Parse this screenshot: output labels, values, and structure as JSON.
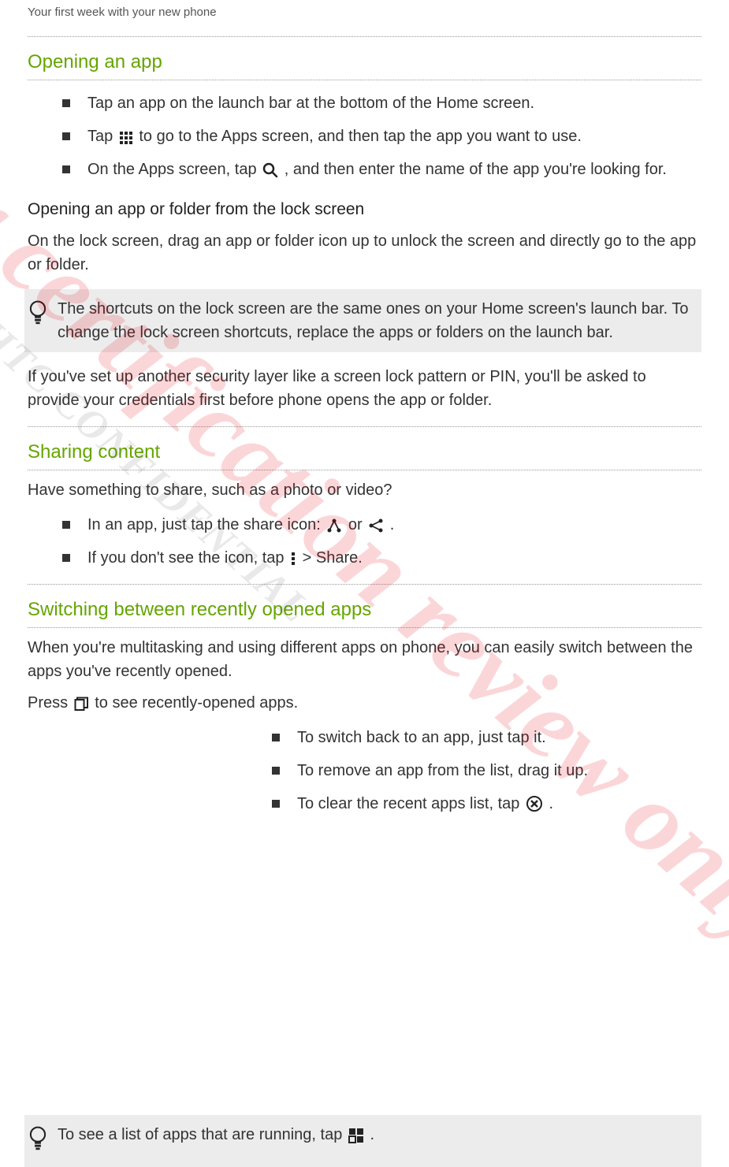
{
  "header": "Your first week with your new phone",
  "s1": {
    "heading": "Opening an app",
    "bullets": {
      "b1": "Tap an app on the launch bar at the bottom of the Home screen.",
      "b2a": "Tap ",
      "b2b": " to go to the Apps screen, and then tap the app you want to use.",
      "b3a": "On the Apps screen, tap ",
      "b3b": ", and then enter the name of the app you're looking for."
    },
    "sub_heading": "Opening an app or folder from the lock screen",
    "p1": "On the lock screen, drag an app or folder icon up to unlock the screen and directly go to the app or folder.",
    "tip": "The shortcuts on the lock screen are the same ones on your Home screen's launch bar. To change the lock screen shortcuts, replace the apps or folders on the launch bar.",
    "p2": "If you've set up another security layer like a screen lock pattern or PIN, you'll be asked to provide your credentials first before phone opens the app or folder."
  },
  "s2": {
    "heading": "Sharing content",
    "p1": "Have something to share, such as a photo or video?",
    "bullets": {
      "b1a": "In an app, just tap the share icon: ",
      "b1b": " or ",
      "b1c": ".",
      "b2a": "If you don't see the icon, tap ",
      "b2b": " > ",
      "b2c": "Share",
      "b2d": "."
    }
  },
  "s3": {
    "heading": "Switching between recently opened apps",
    "p1": "When you're multitasking and using different apps on phone, you can easily switch between the apps you've recently opened.",
    "p2a": "Press ",
    "p2b": " to see recently-opened apps.",
    "bullets": {
      "b1": "To switch back to an app, just tap it.",
      "b2": "To remove an app from the list, drag it up.",
      "b3a": "To clear the recent apps list, tap ",
      "b3b": "."
    },
    "tip_a": "To see a list of apps that are running, tap ",
    "tip_b": "."
  },
  "watermarks": {
    "gray": "HTC CONFIDENTIAL",
    "red": "for certification review only"
  }
}
